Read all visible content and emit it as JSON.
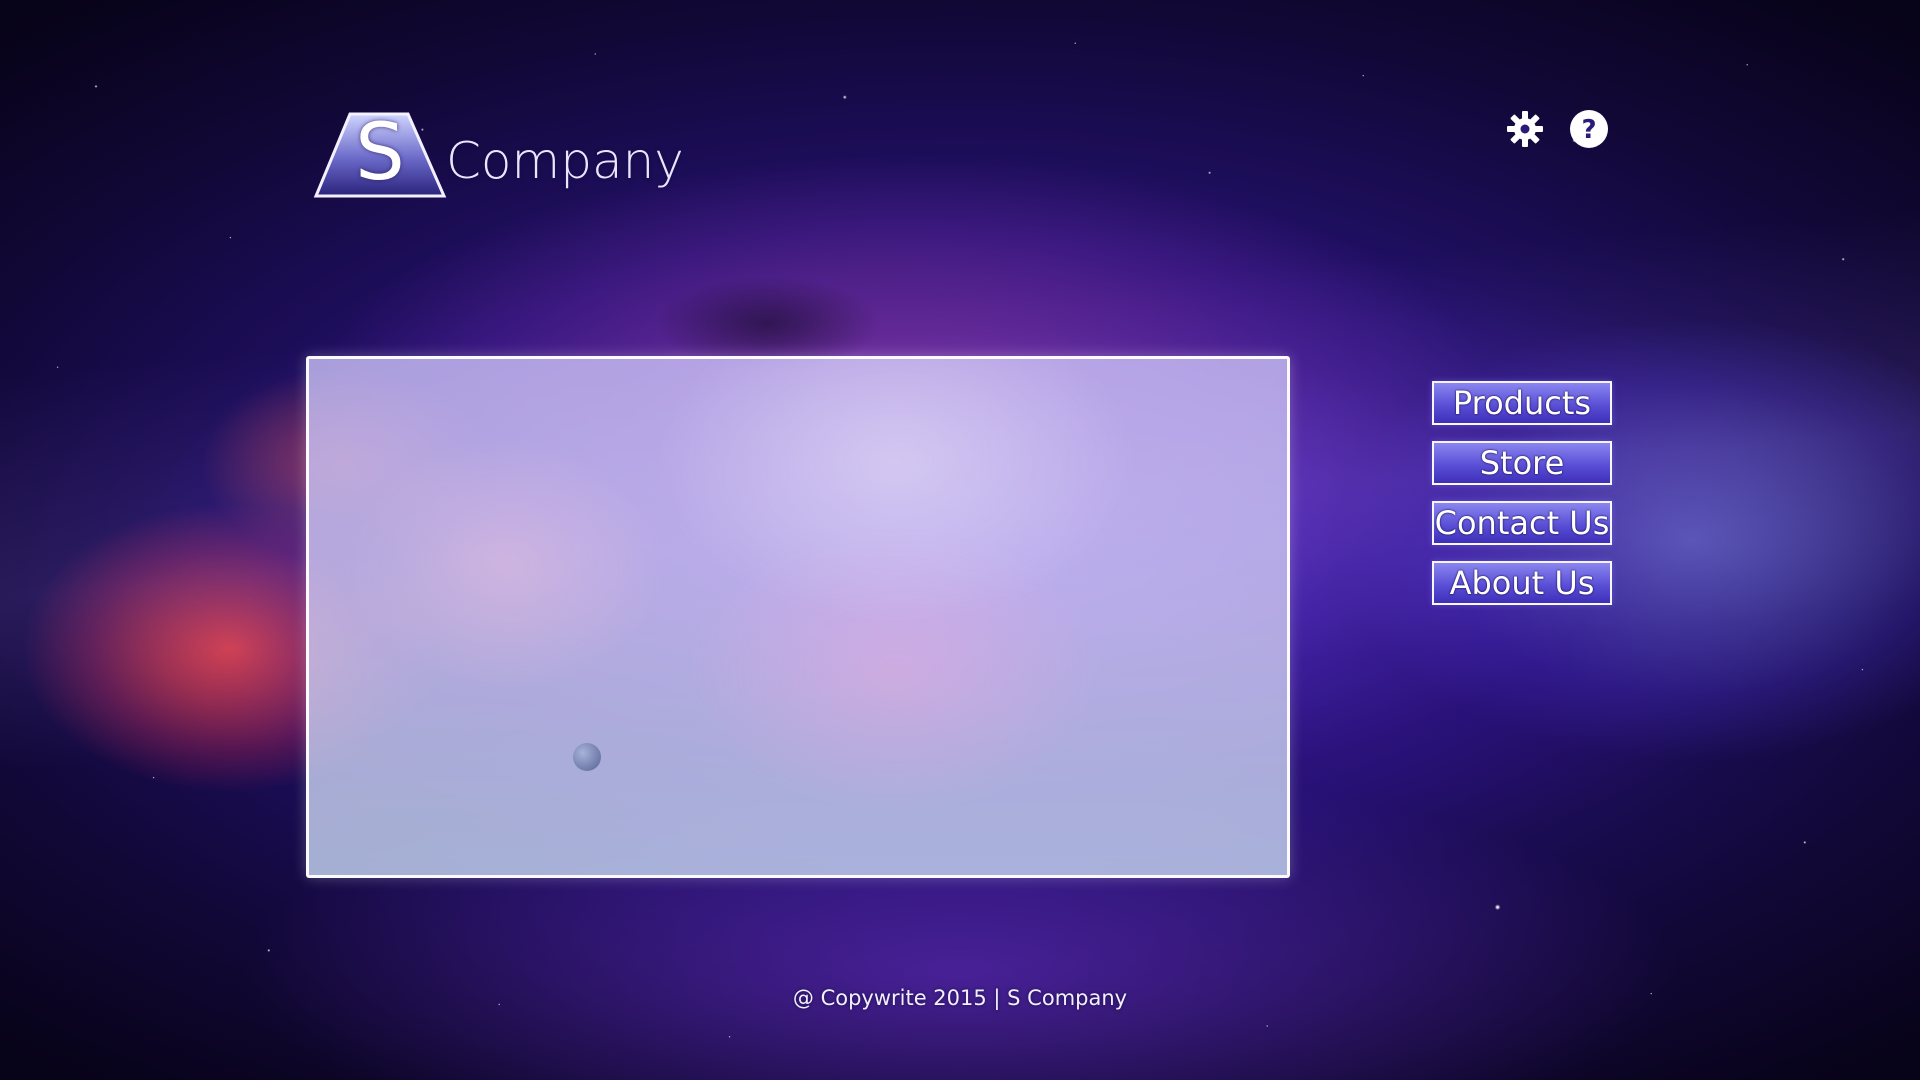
{
  "logo": {
    "letter": "S",
    "word": "Company"
  },
  "toolbar": {
    "icons": [
      "gear-icon",
      "help-icon"
    ]
  },
  "nav": {
    "items": [
      {
        "label": "Products"
      },
      {
        "label": "Store"
      },
      {
        "label": "Contact Us"
      },
      {
        "label": "About Us"
      }
    ]
  },
  "footer": {
    "text": "@ Copywrite 2015 | S Company"
  },
  "colors": {
    "button_top": "#8a86f0",
    "button_bottom": "#3f2fb8",
    "border": "#ffffff",
    "background_deep": "#120838"
  }
}
